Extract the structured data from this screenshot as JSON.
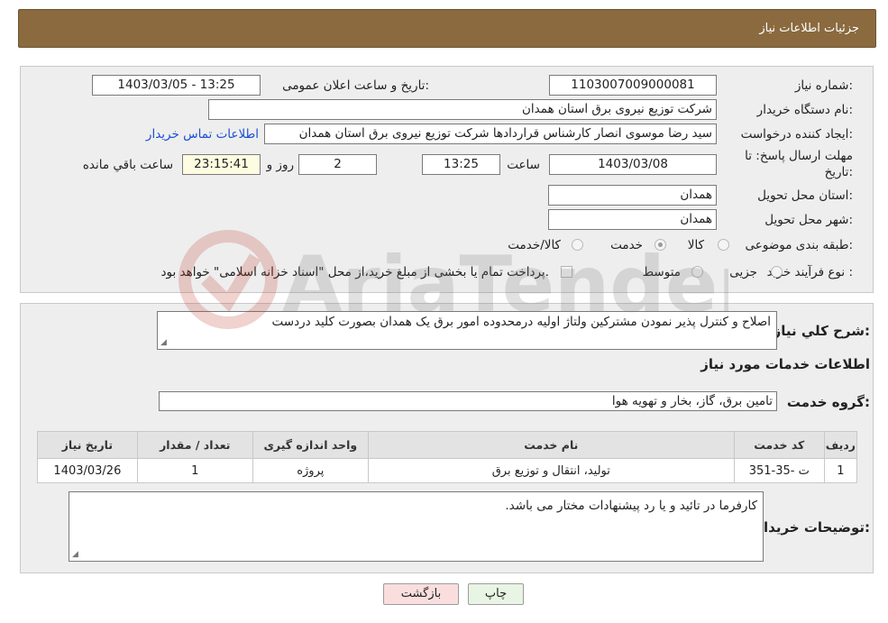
{
  "header": {
    "title": "جزئیات اطلاعات نیاز"
  },
  "form": {
    "need_number_label": "شماره نیاز:",
    "need_number": "1103007009000081",
    "announce_label": "تاریخ و ساعت اعلان عمومی:",
    "announce_value": "1403/03/05 - 13:25",
    "buyer_org_label": "نام دستگاه خریدار:",
    "buyer_org": "شرکت توزیع نیروی برق استان همدان",
    "creator_label": "ایجاد کننده درخواست:",
    "creator": "سید رضا موسوی انصار کارشناس قراردادها شرکت توزیع نیروی برق استان همدان",
    "contact_link": "اطلاعات تماس خریدار",
    "deadline_label_1": "مهلت ارسال پاسخ: تا",
    "deadline_label_2": "تاریخ:",
    "deadline_date": "1403/03/08",
    "hour_label": "ساعت",
    "deadline_time": "13:25",
    "days_value": "2",
    "day_and_label": "روز و",
    "remaining_time": "23:15:41",
    "remaining_label": "ساعت باقي مانده",
    "province_label": "استان محل تحویل:",
    "province": "همدان",
    "city_label": "شهر محل تحویل:",
    "city": "همدان",
    "category_label": "طبقه بندی موضوعی:",
    "category_options": [
      "کالا",
      "خدمت",
      "کالا/خدمت"
    ],
    "process_label": "نوع فرآیند خرید :",
    "process_options": [
      "جزیی",
      "متوسط"
    ],
    "payment_note": "پرداخت تمام یا بخشی از مبلغ خرید،از محل \"اسناد خزانه اسلامی\" خواهد بود."
  },
  "details": {
    "description_label": "شرح کلي نياز:",
    "description": "اصلاح و کنترل پذیر نمودن مشترکین ولتاژ اولیه درمحدوده امور برق یک همدان بصورت کلید دردست",
    "services_info_title": "اطلاعات خدمات مورد نیاز",
    "service_group_label": "گروه خدمت:",
    "service_group": "تامین برق، گاز، بخار و تهویه هوا",
    "table": {
      "headers": [
        "ردیف",
        "کد خدمت",
        "نام خدمت",
        "واحد اندازه گیری",
        "تعداد / مقدار",
        "تاریخ نیاز"
      ],
      "rows": [
        [
          "1",
          "ت -35-351",
          "تولید، انتقال و توزیع برق",
          "پروژه",
          "1",
          "1403/03/26"
        ]
      ]
    },
    "buyer_notes_label": "توضیحات خریدار:",
    "buyer_notes": "کارفرما در تائید و یا رد پیشنهادات مختار می باشد."
  },
  "buttons": {
    "print": "چاپ",
    "back": "بازگشت"
  },
  "watermark": {
    "text": "AriaTender.neT"
  },
  "colors": {
    "header_bg": "#8a6a3e",
    "link": "#1a4fd6",
    "panel_bg": "#eeeeee"
  }
}
